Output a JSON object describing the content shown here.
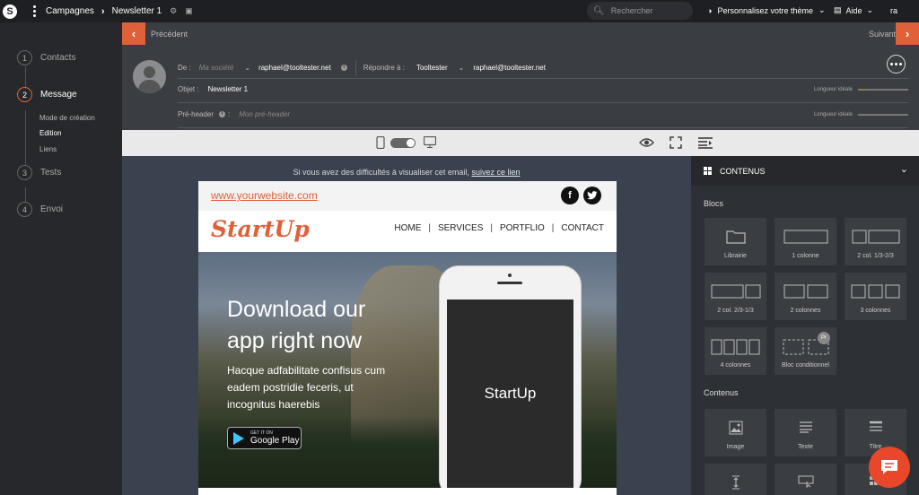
{
  "topbar": {
    "crumb_1": "Campagnes",
    "crumb_2": "Newsletter 1",
    "search_placeholder": "Rechercher",
    "theme_label": "Personnalisez votre thème",
    "help_label": "Aide",
    "user_initials": "ra"
  },
  "steps": [
    {
      "num": "1",
      "label": "Contacts"
    },
    {
      "num": "2",
      "label": "Message"
    },
    {
      "num": "3",
      "label": "Tests"
    },
    {
      "num": "4",
      "label": "Envoi"
    }
  ],
  "message_substeps": [
    "Mode de création",
    "Edition",
    "Liens"
  ],
  "nav": {
    "prev": "Précédent",
    "next": "Suivant"
  },
  "header": {
    "from_label": "De :",
    "sender_placeholder": "Ma société",
    "from_email": "raphael@tooltester.net",
    "reply_label": "Répondre à :",
    "reply_name": "Tooltester",
    "reply_email": "raphael@tooltester.net",
    "subject_label": "Objet :",
    "subject_value": "Newsletter 1",
    "preheader_label": "Pré-header",
    "preheader_placeholder": "Mon pré-header",
    "length_label": "Longueur idéale"
  },
  "canvas": {
    "fallback_text": "Si vous avez des difficultés à visualiser cet email,",
    "fallback_link": "suivez ce lien"
  },
  "email": {
    "url": "www.yourwebsite.com",
    "brand": "StartUp",
    "menu": [
      "HOME",
      "SERVICES",
      "PORTFLIO",
      "CONTACT"
    ],
    "hero_title": "Download our app right now",
    "hero_body": "Hacque adfabilitate confisus cum eadem postridie feceris, ut incognitus haerebis",
    "gplay_small": "GET IT ON",
    "gplay_big": "Google Play",
    "phone_screen": "StartUp"
  },
  "panel": {
    "header": "CONTENUS",
    "blocs_label": "Blocs",
    "blocs": [
      "Librairie",
      "1 colonne",
      "2 col. 1/3-2/3",
      "2 col. 2/3-1/3",
      "2 colonnes",
      "3 colonnes",
      "4 colonnes",
      "Bloc conditionnel"
    ],
    "pr_badge": "Pr",
    "contenus_label": "Contenus",
    "contenus": [
      "Image",
      "Texte",
      "Titre"
    ]
  },
  "colors": {
    "accent": "#e0603a",
    "chat": "#e8472a"
  }
}
